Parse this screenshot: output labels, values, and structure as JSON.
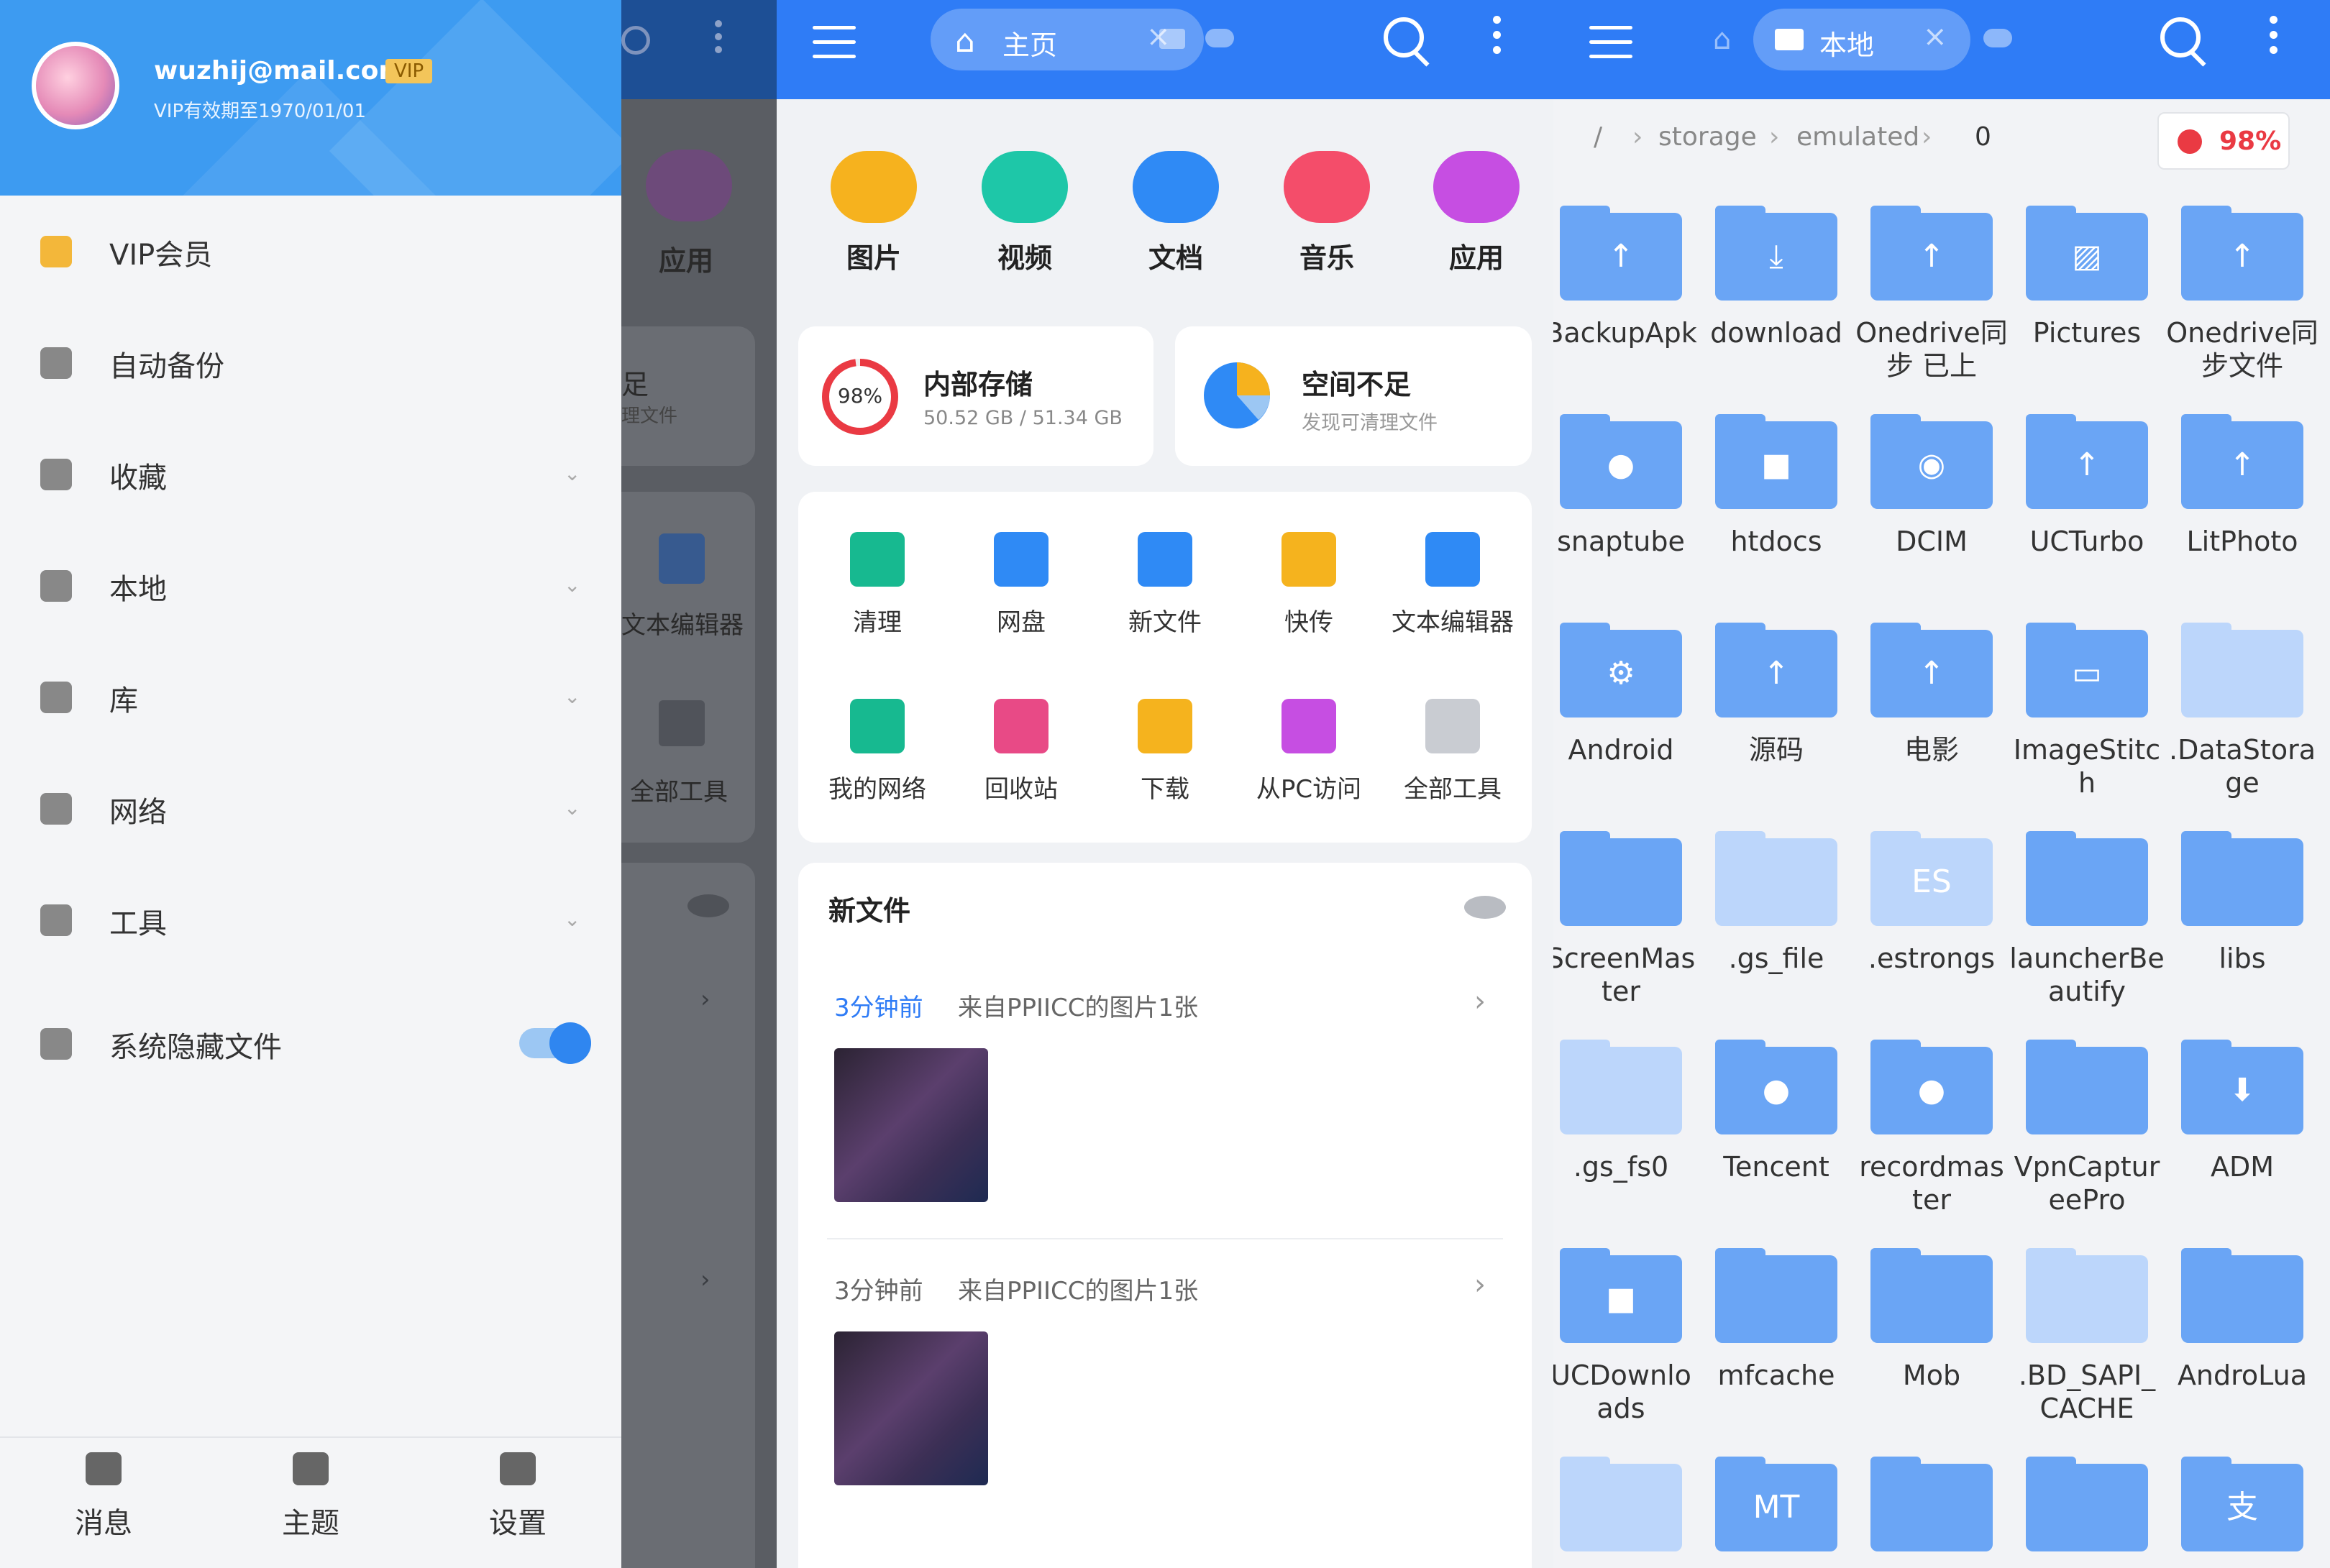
{
  "drawer": {
    "email": "wuzhij@mail.com",
    "vip_tag": "VIP",
    "expiry": "VIP有效期至1970/01/01",
    "items": [
      {
        "label": "VIP会员",
        "icon": "crown-icon",
        "chevron": ""
      },
      {
        "label": "自动备份",
        "icon": "cloud-sync-icon",
        "chevron": ""
      },
      {
        "label": "收藏",
        "icon": "star-icon",
        "chevron": "⌄"
      },
      {
        "label": "本地",
        "icon": "phone-icon",
        "chevron": "⌄"
      },
      {
        "label": "库",
        "icon": "layers-icon",
        "chevron": "⌄"
      },
      {
        "label": "网络",
        "icon": "network-icon",
        "chevron": "⌄"
      },
      {
        "label": "工具",
        "icon": "wrench-icon",
        "chevron": "⌄"
      },
      {
        "label": "系统隐藏文件",
        "icon": "hidden-files-icon",
        "chevron": ""
      }
    ],
    "hidden_files_enabled": true,
    "bottom": [
      {
        "label": "消息",
        "icon": "message-icon"
      },
      {
        "label": "主题",
        "icon": "shirt-icon"
      },
      {
        "label": "设置",
        "icon": "gear-icon"
      }
    ]
  },
  "shade": {
    "labels": [
      "应用",
      "足",
      "理文件",
      "文本编辑器",
      "全部工具"
    ]
  },
  "home": {
    "tab_label": "主页",
    "categories": [
      {
        "label": "图片",
        "icon": "image-icon",
        "color": "#f6b21e"
      },
      {
        "label": "视频",
        "icon": "video-icon",
        "color": "#1ec7a8"
      },
      {
        "label": "文档",
        "icon": "document-icon",
        "color": "#2f8af5"
      },
      {
        "label": "音乐",
        "icon": "music-icon",
        "color": "#f44d6a"
      },
      {
        "label": "应用",
        "icon": "android-icon",
        "color": "#c64ee2"
      }
    ],
    "storage": {
      "percent": "98%",
      "title": "内部存储",
      "detail": "50.52 GB / 51.34 GB"
    },
    "space": {
      "title": "空间不足",
      "detail": "发现可清理文件"
    },
    "tools": [
      {
        "label": "清理",
        "icon": "broom-icon",
        "color": "#17b990"
      },
      {
        "label": "网盘",
        "icon": "cloud-drive-icon",
        "color": "#2f8af5"
      },
      {
        "label": "新文件",
        "icon": "new-file-icon",
        "color": "#2f8af5"
      },
      {
        "label": "快传",
        "icon": "paper-plane-icon",
        "color": "#f5b31e"
      },
      {
        "label": "文本编辑器",
        "icon": "text-editor-icon",
        "color": "#2f8af5"
      },
      {
        "label": "我的网络",
        "icon": "router-icon",
        "color": "#17b990"
      },
      {
        "label": "回收站",
        "icon": "trash-icon",
        "color": "#e84a86"
      },
      {
        "label": "下载",
        "icon": "download-icon",
        "color": "#f5b31e"
      },
      {
        "label": "从PC访问",
        "icon": "pc-access-icon",
        "color": "#c64ee2"
      },
      {
        "label": "全部工具",
        "icon": "grid-icon",
        "color": "#c9ccd2"
      }
    ],
    "new_files": {
      "title": "新文件",
      "entries": [
        {
          "time": "3分钟前",
          "source": "来自PPIICC的图片1张",
          "time_color": "#2f7cf6"
        },
        {
          "time": "3分钟前",
          "source": "来自PPIICC的图片1张",
          "time_color": "#666666"
        }
      ]
    }
  },
  "local": {
    "tab_label": "本地",
    "breadcrumb": {
      "root": "/",
      "parts": [
        "storage",
        "emulated",
        "0"
      ]
    },
    "usage": "98%",
    "folders": [
      {
        "name": "BackupApk",
        "glyph": "↑",
        "light": false
      },
      {
        "name": "download",
        "glyph": "⤓",
        "light": false
      },
      {
        "name": "Onedrive同步 已上",
        "glyph": "↑",
        "light": false
      },
      {
        "name": "Pictures",
        "glyph": "▨",
        "light": false
      },
      {
        "name": "Onedrive同步文件",
        "glyph": "↑",
        "light": false
      },
      {
        "name": "snaptube",
        "glyph": "●",
        "light": false
      },
      {
        "name": "htdocs",
        "glyph": "■",
        "light": false
      },
      {
        "name": "DCIM",
        "glyph": "◉",
        "light": false
      },
      {
        "name": "UCTurbo",
        "glyph": "↑",
        "light": false
      },
      {
        "name": "LitPhoto",
        "glyph": "↑",
        "light": false
      },
      {
        "name": "Android",
        "glyph": "⚙",
        "light": false
      },
      {
        "name": "源码",
        "glyph": "↑",
        "light": false
      },
      {
        "name": "电影",
        "glyph": "↑",
        "light": false
      },
      {
        "name": "ImageStitch",
        "glyph": "▭",
        "light": false
      },
      {
        "name": ".DataStorage",
        "glyph": "",
        "light": true
      },
      {
        "name": "ScreenMaster",
        "glyph": "",
        "light": false
      },
      {
        "name": ".gs_file",
        "glyph": "",
        "light": true
      },
      {
        "name": ".estrongs",
        "glyph": "ES",
        "light": true
      },
      {
        "name": "launcherBeautify",
        "glyph": "",
        "light": false
      },
      {
        "name": "libs",
        "glyph": "",
        "light": false
      },
      {
        "name": ".gs_fs0",
        "glyph": "",
        "light": true
      },
      {
        "name": "Tencent",
        "glyph": "●",
        "light": false
      },
      {
        "name": "recordmaster",
        "glyph": "●",
        "light": false
      },
      {
        "name": "VpnCaptureePro",
        "glyph": "",
        "light": false
      },
      {
        "name": "ADM",
        "glyph": "⬇",
        "light": false
      },
      {
        "name": "UCDownloads",
        "glyph": "■",
        "light": false
      },
      {
        "name": "mfcache",
        "glyph": "",
        "light": false
      },
      {
        "name": "Mob",
        "glyph": "",
        "light": false
      },
      {
        "name": ".BD_SAPI_CACHE",
        "glyph": "",
        "light": true
      },
      {
        "name": "AndroLua",
        "glyph": "",
        "light": false
      },
      {
        "name": "",
        "glyph": "",
        "light": true
      },
      {
        "name": "",
        "glyph": "MT",
        "light": false
      },
      {
        "name": "",
        "glyph": "",
        "light": false
      },
      {
        "name": "",
        "glyph": "",
        "light": false
      },
      {
        "name": "",
        "glyph": "支",
        "light": false
      }
    ]
  }
}
